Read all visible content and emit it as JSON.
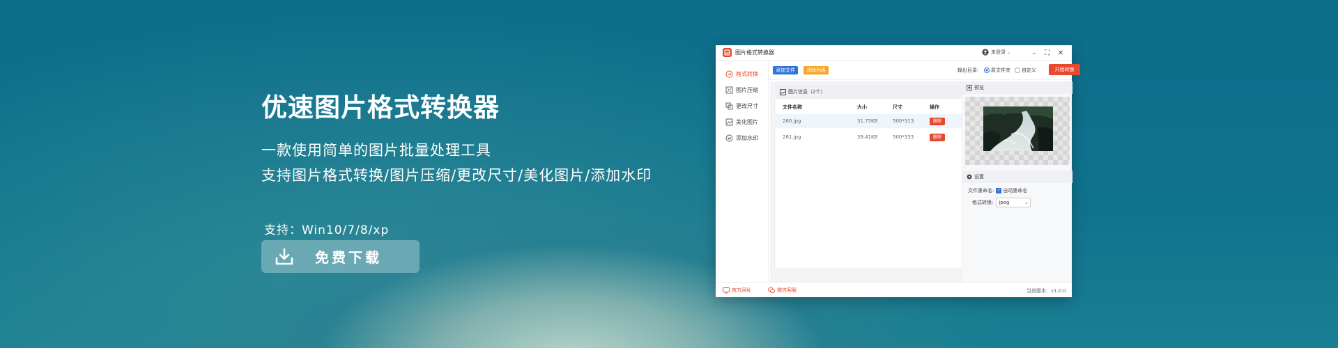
{
  "hero": {
    "title": "优速图片格式转换器",
    "subtitle_1": "一款使用简单的图片批量处理工具",
    "subtitle_2": "支持图片格式转换/图片压缩/更改尺寸/美化图片/添加水印",
    "support": "支持：Win10/7/8/xp",
    "download_label": "免费下载"
  },
  "window": {
    "app_title": "图片格式转换器",
    "login_label": "未登录",
    "controls": {
      "minimize": "–",
      "maximize": "⛶",
      "close": "✕"
    }
  },
  "sidebar": {
    "items": [
      {
        "label": "格式转换",
        "active": true,
        "icon": "convert-icon"
      },
      {
        "label": "图片压缩",
        "active": false,
        "icon": "compress-icon"
      },
      {
        "label": "更改尺寸",
        "active": false,
        "icon": "resize-icon"
      },
      {
        "label": "美化图片",
        "active": false,
        "icon": "beautify-icon"
      },
      {
        "label": "添加水印",
        "active": false,
        "icon": "watermark-icon"
      }
    ]
  },
  "toolbar": {
    "add_file": "添加文件",
    "clear_list": "清除列表",
    "output_label": "输出目录:",
    "option_original": "原文件夹",
    "option_custom": "自定义",
    "start": "开始转换"
  },
  "file_panel": {
    "header": "图片信息（2个）",
    "columns": [
      "文件名称",
      "大小",
      "尺寸",
      "操作"
    ],
    "rows": [
      {
        "name": "260.jpg",
        "size": "31.75KB",
        "dimensions": "500*313",
        "action": "删除"
      },
      {
        "name": "261.jpg",
        "size": "39.41KB",
        "dimensions": "500*333",
        "action": "删除"
      }
    ]
  },
  "preview": {
    "header": "预览"
  },
  "settings": {
    "header": "设置",
    "rename_label": "文件重命名:",
    "auto_rename": "自动重命名",
    "format_label": "格式转换:",
    "format_value": "jpeg"
  },
  "statusbar": {
    "website": "官方网址",
    "wechat": "微信客服",
    "version": "当前版本：v1.0.0"
  },
  "colors": {
    "accent": "#e8482f",
    "add_file": "#2f73d8",
    "clear_list": "#f5a623",
    "bg_teal": "#10738e"
  }
}
